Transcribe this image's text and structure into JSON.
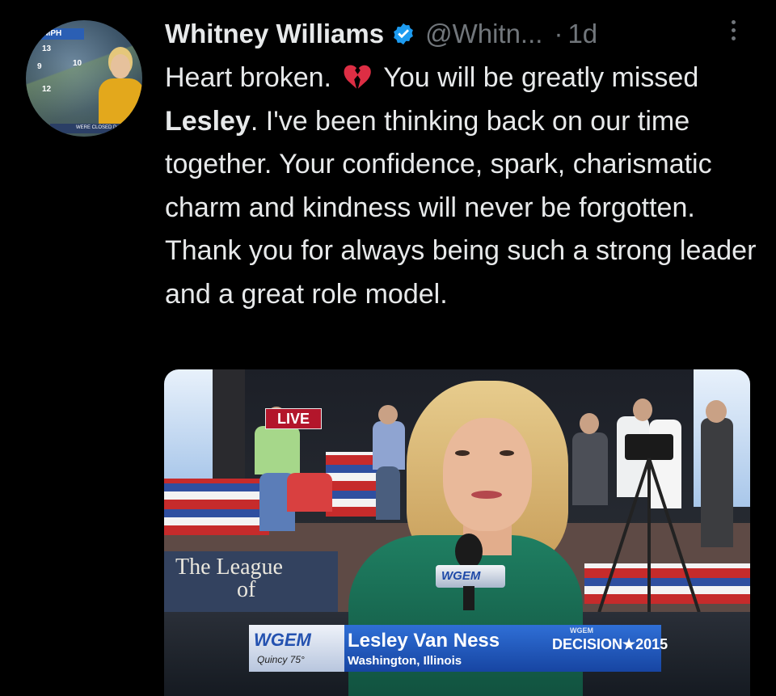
{
  "tweet": {
    "author_name": "Whitney Williams",
    "handle": "@Whitn...",
    "separator": "·",
    "time": "1d",
    "text_parts": [
      "Heart broken. ",
      " You will be greatly missed ",
      "Lesley",
      ". I've been thinking back on our time together. Your confidence, spark, charismatic charm and kindness will never be forgotten. Thank you for always being such a strong leader and a great role model."
    ]
  },
  "avatar": {
    "top_label": "MPH",
    "nums": [
      "13",
      "10",
      "9",
      "12"
    ],
    "bottom_label": "WERE CLOSED D"
  },
  "media": {
    "live_label": "LIVE",
    "banner_text_line1": "The League",
    "banner_text_line2": "of",
    "mic_flag": "WGEM",
    "lower_third": {
      "station": "WGEM",
      "city_temp": "Quincy  75°",
      "name": "Lesley Van Ness",
      "location": "Washington, Illinois",
      "decision_small": "WGEM",
      "decision": "DECISION★2015"
    }
  },
  "colors": {
    "background": "#000000",
    "primary_text": "#e7e9ea",
    "secondary_text": "#71767b",
    "verified_blue": "#1d9bf0",
    "heart_red": "#dd2e44"
  }
}
